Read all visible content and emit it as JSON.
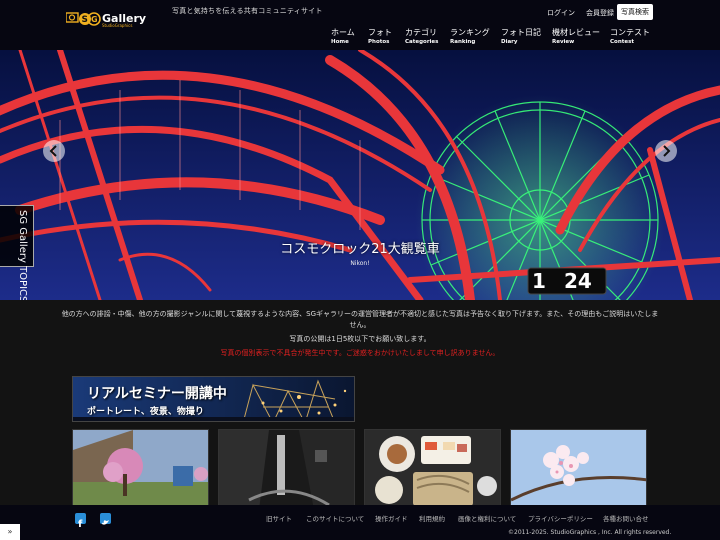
{
  "header": {
    "logo_text": "Gallery",
    "logo_sub": "StudioGraphics",
    "tagline": "写真と気持ちを伝える共有コミュニティサイト",
    "login": "ログイン",
    "register": "会員登録",
    "photo_search": "写真検索",
    "nav": [
      {
        "jp": "ホーム",
        "en": "Home"
      },
      {
        "jp": "フォト",
        "en": "Photos"
      },
      {
        "jp": "カテゴリ",
        "en": "Categories"
      },
      {
        "jp": "ランキング",
        "en": "Ranking"
      },
      {
        "jp": "フォト日記",
        "en": "Diary"
      },
      {
        "jp": "機材レビュー",
        "en": "Review"
      },
      {
        "jp": "コンテスト",
        "en": "Contest"
      }
    ]
  },
  "hero": {
    "topics_label": "SG Gallery TOPICS",
    "slide_title": "コスモクロック21大観覧車",
    "slide_author": "Nikon!",
    "clock_text": "24"
  },
  "notice": {
    "line1": "他の方への誹謗・中傷、他の方の撮影ジャンルに関して蔑視するような内容、SGギャラリーの運営管理者が不適切と感じた写真は予告なく取り下げます。また、その理由もご説明はいたしません。",
    "line2": "写真の公開は1日5枚以下でお願い致します。",
    "line3": "写真の個別表示で不具合が発生中です。ご迷惑をおかけいたしまして申し訳ありません。"
  },
  "banner": {
    "title": "リアルセミナー開講中",
    "subtitle": "ポートレート、夜景、物撮り"
  },
  "thumbnails": [
    "cherry-blossom-tree",
    "waterfall-monochrome",
    "japanese-meal",
    "cherry-blossom-closeup"
  ],
  "footer": {
    "links": [
      "旧サイト",
      "このサイトについて",
      "操作ガイド",
      "利用規約",
      "画像と権利について",
      "プライバシーポリシー",
      "各種お問い合せ"
    ],
    "copyright": "©2011-2025. StudioGraphics , Inc. All rights reserved.",
    "back_to_top": "»"
  },
  "colors": {
    "header_bg": "#060611",
    "body_bg": "#131313",
    "alert": "#e02020",
    "sns_blue": "#2a8ed8"
  }
}
